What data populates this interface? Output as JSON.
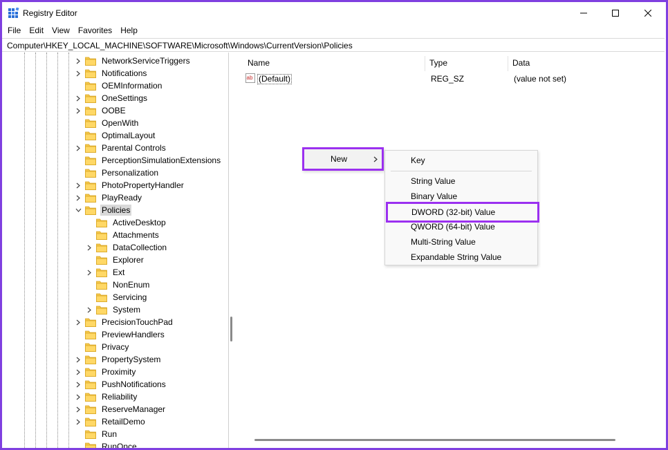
{
  "window": {
    "title": "Registry Editor"
  },
  "menu": [
    "File",
    "Edit",
    "View",
    "Favorites",
    "Help"
  ],
  "address": "Computer\\HKEY_LOCAL_MACHINE\\SOFTWARE\\Microsoft\\Windows\\CurrentVersion\\Policies",
  "tree": [
    {
      "label": "NetworkServiceTriggers",
      "level": 0,
      "expander": "collapsed"
    },
    {
      "label": "Notifications",
      "level": 0,
      "expander": "collapsed"
    },
    {
      "label": "OEMInformation",
      "level": 0,
      "expander": "none"
    },
    {
      "label": "OneSettings",
      "level": 0,
      "expander": "collapsed"
    },
    {
      "label": "OOBE",
      "level": 0,
      "expander": "collapsed"
    },
    {
      "label": "OpenWith",
      "level": 0,
      "expander": "none"
    },
    {
      "label": "OptimalLayout",
      "level": 0,
      "expander": "none"
    },
    {
      "label": "Parental Controls",
      "level": 0,
      "expander": "collapsed"
    },
    {
      "label": "PerceptionSimulationExtensions",
      "level": 0,
      "expander": "none"
    },
    {
      "label": "Personalization",
      "level": 0,
      "expander": "none"
    },
    {
      "label": "PhotoPropertyHandler",
      "level": 0,
      "expander": "collapsed"
    },
    {
      "label": "PlayReady",
      "level": 0,
      "expander": "collapsed"
    },
    {
      "label": "Policies",
      "level": 0,
      "expander": "expanded",
      "selected": true
    },
    {
      "label": "ActiveDesktop",
      "level": 1,
      "expander": "none"
    },
    {
      "label": "Attachments",
      "level": 1,
      "expander": "none"
    },
    {
      "label": "DataCollection",
      "level": 1,
      "expander": "collapsed"
    },
    {
      "label": "Explorer",
      "level": 1,
      "expander": "none"
    },
    {
      "label": "Ext",
      "level": 1,
      "expander": "collapsed"
    },
    {
      "label": "NonEnum",
      "level": 1,
      "expander": "none"
    },
    {
      "label": "Servicing",
      "level": 1,
      "expander": "none"
    },
    {
      "label": "System",
      "level": 1,
      "expander": "collapsed"
    },
    {
      "label": "PrecisionTouchPad",
      "level": 0,
      "expander": "collapsed"
    },
    {
      "label": "PreviewHandlers",
      "level": 0,
      "expander": "none"
    },
    {
      "label": "Privacy",
      "level": 0,
      "expander": "none"
    },
    {
      "label": "PropertySystem",
      "level": 0,
      "expander": "collapsed"
    },
    {
      "label": "Proximity",
      "level": 0,
      "expander": "collapsed"
    },
    {
      "label": "PushNotifications",
      "level": 0,
      "expander": "collapsed"
    },
    {
      "label": "Reliability",
      "level": 0,
      "expander": "collapsed"
    },
    {
      "label": "ReserveManager",
      "level": 0,
      "expander": "collapsed"
    },
    {
      "label": "RetailDemo",
      "level": 0,
      "expander": "collapsed"
    },
    {
      "label": "Run",
      "level": 0,
      "expander": "none"
    },
    {
      "label": "RunOnce",
      "level": 0,
      "expander": "none"
    }
  ],
  "list": {
    "columns": [
      "Name",
      "Type",
      "Data"
    ],
    "rows": [
      {
        "name": "(Default)",
        "type": "REG_SZ",
        "data": "(value not set)",
        "icon": "string-value-icon"
      }
    ]
  },
  "context_menu": {
    "new_label": "New",
    "submenu": [
      "Key",
      "String Value",
      "Binary Value",
      "DWORD (32-bit) Value",
      "QWORD (64-bit) Value",
      "Multi-String Value",
      "Expandable String Value"
    ],
    "highlighted": "DWORD (32-bit) Value",
    "highlight_color": "#9b30f0"
  },
  "colors": {
    "background_frame": "#7f3fe0",
    "folder": "#f5c84c",
    "selected_row": "#d9d9d9"
  }
}
